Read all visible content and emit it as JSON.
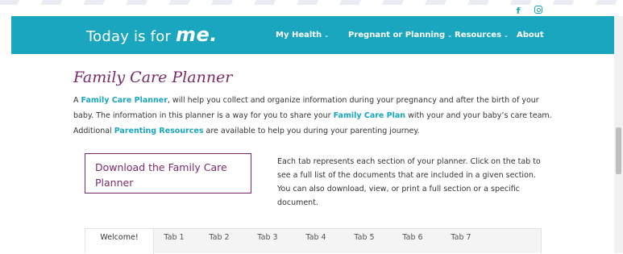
{
  "social": {
    "facebook_glyph": "f",
    "facebook_icon": "facebook-icon",
    "instagram_icon": "instagram-icon"
  },
  "header": {
    "logo_prefix": "Today is for ",
    "logo_emphasis": "me.",
    "nav": [
      {
        "label": "My Health",
        "has_dropdown": true
      },
      {
        "label": "Pregnant or Planning",
        "has_dropdown": true
      },
      {
        "label": "Resources",
        "has_dropdown": true
      },
      {
        "label": "About",
        "has_dropdown": false
      }
    ],
    "chevron": "⌄"
  },
  "main": {
    "title": "Family Care Planner",
    "intro": {
      "p1": "A ",
      "link1": "Family Care Planner",
      "p2": ", will help you collect and organize information during your pregnancy and after the birth of your baby. The information in this planner is a way for you to share your ",
      "link2": "Family Care Plan",
      "p3": " with your and your baby’s care team. Additional ",
      "link3": "Parenting Resources",
      "p4": " are available to help you during your parenting journey."
    },
    "download_button": "Download the Family Care Planner",
    "tab_description": "Each tab represents each section of your planner. Click on the tab to see a full list of the documents that are included in a given section. You can also download, view, or print a full section or a specific document.",
    "tabs": [
      "Welcome!",
      "Tab 1",
      "Tab 2",
      "Tab 3",
      "Tab 4",
      "Tab 5",
      "Tab 6",
      "Tab 7"
    ],
    "active_tab": "Welcome!"
  },
  "colors": {
    "brand_teal": "#1aa6be",
    "title_plum": "#7a2a6a"
  }
}
